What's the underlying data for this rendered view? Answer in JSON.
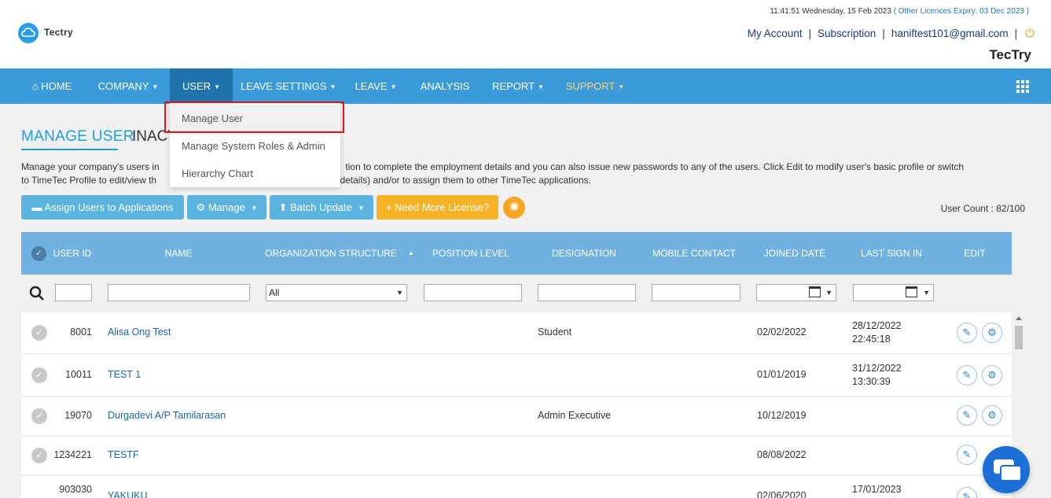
{
  "header": {
    "logo_text": "Tectry",
    "datetime": "11:41:51 Wednesday, 15 Feb 2023",
    "licence_text": "( Other Licences Expiry:  03 Dec 2023 )",
    "links": [
      "My Account",
      "Subscription",
      "haniftest101@gmail.com"
    ],
    "separator": "|",
    "brand_name": "TecTry"
  },
  "nav": {
    "items": [
      {
        "label": "HOME",
        "caret": false
      },
      {
        "label": "COMPANY",
        "caret": true
      },
      {
        "label": "USER",
        "caret": true
      },
      {
        "label": "LEAVE SETTINGS",
        "caret": true
      },
      {
        "label": "LEAVE",
        "caret": true
      },
      {
        "label": "ANALYSIS",
        "caret": false
      },
      {
        "label": "REPORT",
        "caret": true
      },
      {
        "label": "SUPPORT",
        "caret": true
      }
    ],
    "active_index": 2,
    "caret_glyph": "▼",
    "home_glyph": "⌂"
  },
  "dropdown": {
    "items": [
      "Manage User",
      "Manage System Roles & Admin",
      "Hierarchy Chart"
    ]
  },
  "page": {
    "tab_active": "MANAGE USER",
    "tab_inactive": "INACT",
    "description_line1": "Manage your company's users in                                                                       tion to complete the employment details and you can also issue new passwords to any of the users. Click Edit to modify user's basic profile or switch",
    "description_line2": "to TimeTec Profile to edit/view th                                                                    t details) and/or to assign them to other TimeTec applications.",
    "user_count": "User Count : 82/100"
  },
  "actions": {
    "assign": "Assign Users to Applications",
    "manage": "Manage",
    "batch_update": "Batch Update",
    "need_license": "Need More License?",
    "assign_glyph": "▬",
    "manage_glyph": "⚙",
    "batch_glyph": "⬆",
    "license_glyph": "+",
    "bulb_glyph": "✺"
  },
  "table": {
    "columns": [
      "USER ID",
      "NAME",
      "ORGANIZATION STRUCTURE",
      "POSITION LEVEL",
      "DESIGNATION",
      "MOBILE CONTACT",
      "JOINED DATE",
      "LAST SIGN IN",
      "EDIT"
    ],
    "org_filter_value": "All",
    "rows": [
      {
        "id": "8001",
        "name": "Alisa Ong Test",
        "designation": "Student",
        "joined": "02/02/2022",
        "last_sign_date": "28/12/2022",
        "last_sign_time": "22:45:18"
      },
      {
        "id": "10011",
        "name": "TEST 1",
        "designation": "",
        "joined": "01/01/2019",
        "last_sign_date": "31/12/2022",
        "last_sign_time": "13:30:39"
      },
      {
        "id": "19070",
        "name": "Durgadevi A/P Tamilarasan",
        "designation": "Admin Executive",
        "joined": "10/12/2019",
        "last_sign_date": "",
        "last_sign_time": ""
      },
      {
        "id": "1234221",
        "name": "TESTF",
        "designation": "",
        "joined": "08/08/2022",
        "last_sign_date": "",
        "last_sign_time": ""
      },
      {
        "id": "903030",
        "name": "YAKUKU",
        "designation": "",
        "joined": "02/06/2020",
        "last_sign_date": "17/01/2023",
        "last_sign_time": ""
      }
    ]
  },
  "icons": {
    "check_glyph": "✓",
    "search_glyph": "⚲",
    "edit_glyph": "✎",
    "settings_glyph": "⚙",
    "power_glyph": "⏻"
  },
  "colors": {
    "nav_bg": "#3b9ad9",
    "nav_active": "#1f74ad",
    "accent": "#1aa0dd",
    "button_blue": "#5bb4e0",
    "button_orange": "#f5b325",
    "highlight_border": "#e0141e"
  }
}
